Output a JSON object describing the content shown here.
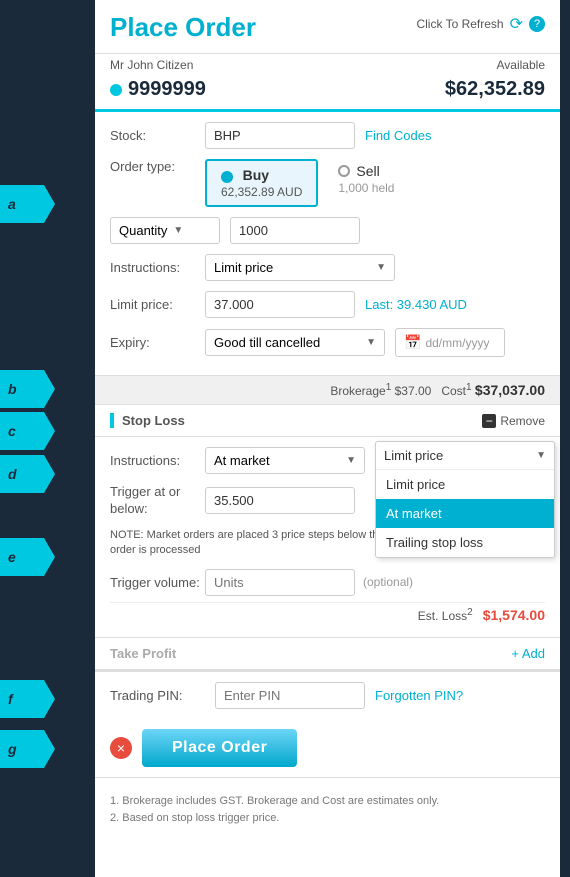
{
  "page": {
    "title": "Place Order",
    "click_to_refresh": "Click To Refresh",
    "user_name": "Mr John Citizen",
    "available_label": "Available",
    "account_number": "9999999",
    "available_amount": "$62,352.89"
  },
  "form": {
    "stock_label": "Stock:",
    "stock_value": "BHP",
    "find_codes": "Find Codes",
    "order_type_label": "Order type:",
    "buy_label": "Buy",
    "buy_sub": "62,352.89 AUD",
    "sell_label": "Sell",
    "sell_sub": "1,000 held",
    "quantity_label": "Quantity",
    "quantity_value": "1000",
    "instructions_label": "Instructions:",
    "instructions_value": "Limit price",
    "limit_price_label": "Limit price:",
    "limit_price_value": "37.000",
    "last_price": "Last: 39.430 AUD",
    "expiry_label": "Expiry:",
    "expiry_value": "Good till cancelled",
    "date_placeholder": "dd/mm/yyyy",
    "brokerage_text": "Brokerage",
    "brokerage_sup": "1",
    "brokerage_amount": "$37.00",
    "cost_label": "Cost",
    "cost_sup": "1",
    "cost_amount": "$37,037.00"
  },
  "stop_loss": {
    "title": "Stop Loss",
    "remove_label": "Remove",
    "instructions_label": "Instructions:",
    "instructions_value": "At market",
    "dropdown_title": "Limit price",
    "dropdown_options": [
      "Limit price",
      "At market",
      "Trailing stop loss"
    ],
    "selected_option": "At market",
    "trigger_label": "Trigger at or below:",
    "trigger_value": "35.500",
    "note_text": "NOTE: Market orders are placed 3 price steps below the best bid price at the time the order is processed",
    "trigger_volume_label": "Trigger volume:",
    "trigger_volume_placeholder": "Units",
    "optional_text": "(optional)",
    "est_loss_label": "Est. Loss",
    "est_loss_sup": "2",
    "est_loss_amount": "$1,574.00"
  },
  "take_profit": {
    "title": "Take Profit",
    "add_label": "+ Add"
  },
  "trading_pin": {
    "label": "Trading PIN:",
    "placeholder": "Enter PIN",
    "forgotten_link": "Forgotten PIN?"
  },
  "actions": {
    "place_order_label": "Place Order",
    "cancel_icon": "×"
  },
  "footnotes": {
    "note1": "1. Brokerage includes GST. Brokerage and Cost are estimates only.",
    "note2": "2. Based on stop loss trigger price."
  },
  "side_labels": {
    "a": "a",
    "b": "b",
    "c": "c",
    "d": "d",
    "e": "e",
    "f": "f",
    "g": "g"
  }
}
